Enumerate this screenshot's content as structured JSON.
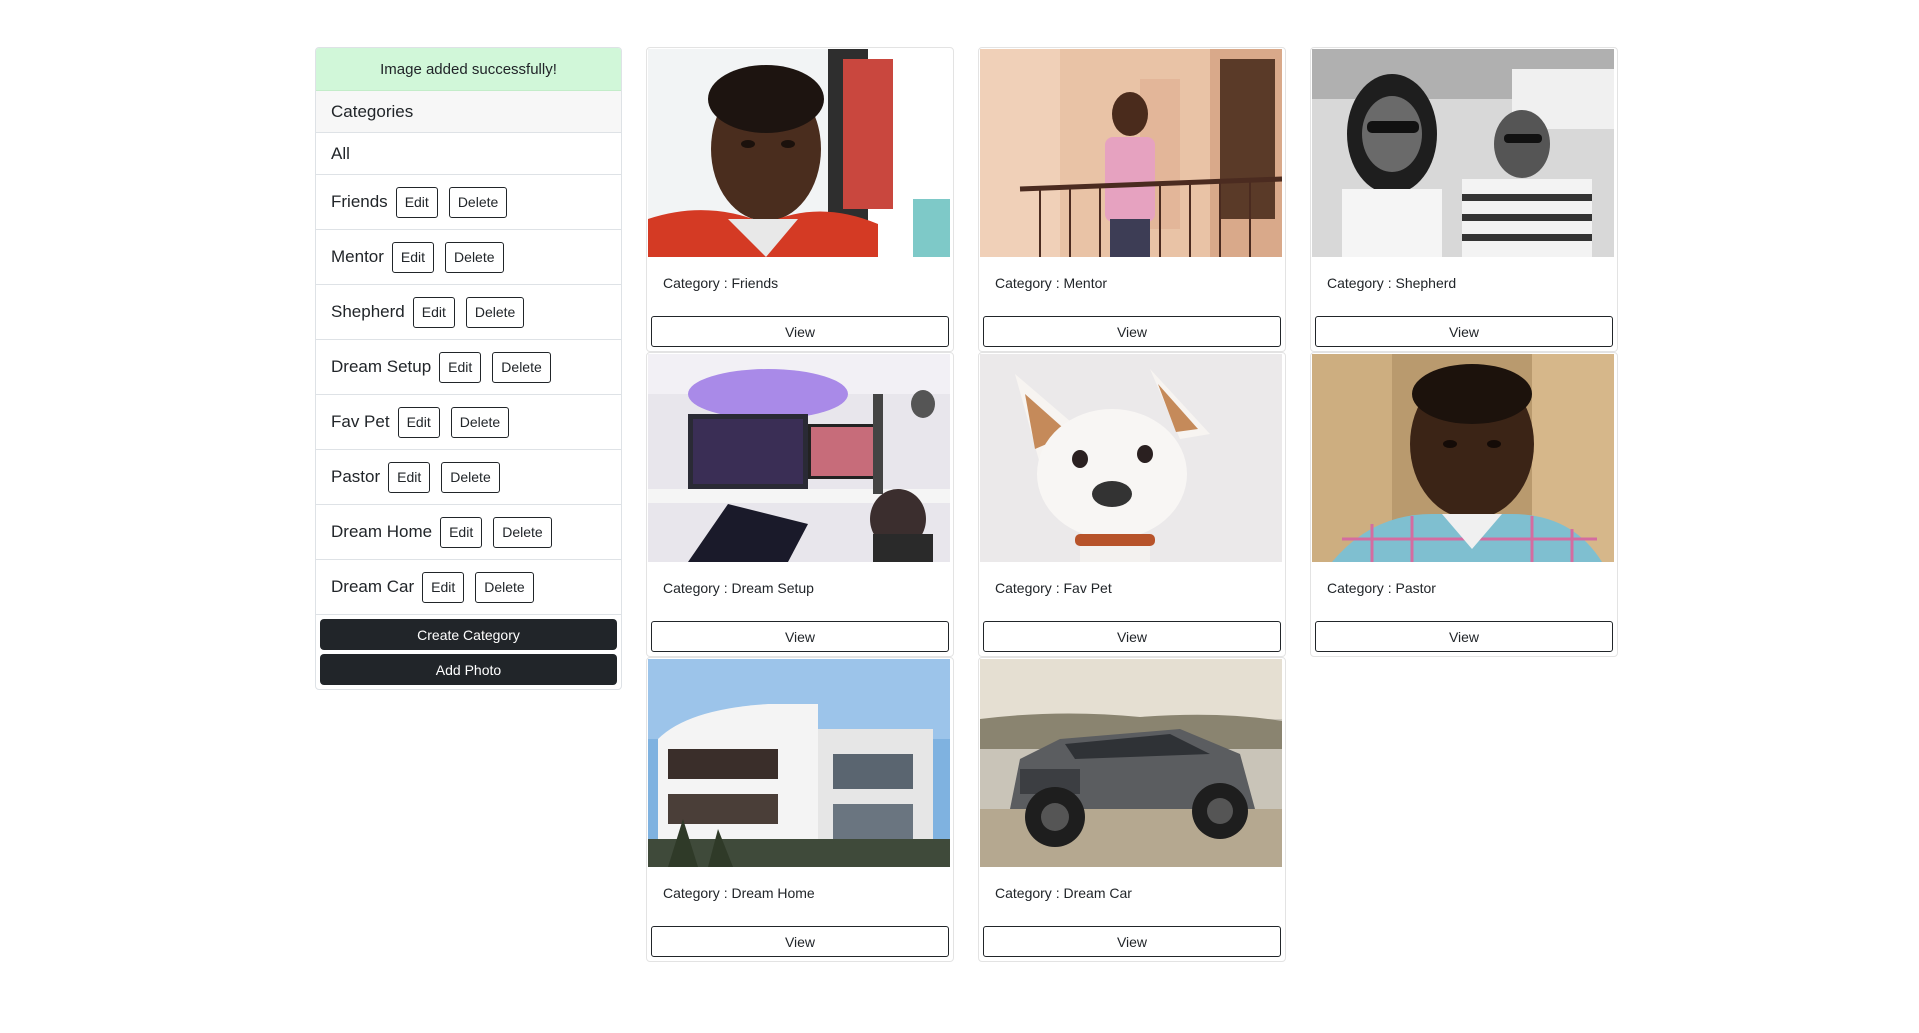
{
  "alert": {
    "message": "Image added successfully!"
  },
  "sidebar": {
    "header": "Categories",
    "all_label": "All",
    "edit_label": "Edit",
    "delete_label": "Delete",
    "items": [
      {
        "name": "Friends"
      },
      {
        "name": "Mentor"
      },
      {
        "name": "Shepherd"
      },
      {
        "name": "Dream Setup"
      },
      {
        "name": "Fav Pet"
      },
      {
        "name": "Pastor"
      },
      {
        "name": "Dream Home"
      },
      {
        "name": "Dream Car"
      }
    ],
    "create_category_label": "Create Category",
    "add_photo_label": "Add Photo"
  },
  "gallery": {
    "view_label": "View",
    "cards": [
      {
        "category": "Category : Friends",
        "image": "selfie of young man"
      },
      {
        "category": "Category : Mentor",
        "image": "man on balcony"
      },
      {
        "category": "Category : Shepherd",
        "image": "couple in car black and white"
      },
      {
        "category": "Category : Dream Setup",
        "image": "gaming desk setup"
      },
      {
        "category": "Category : Fav Pet",
        "image": "white dog"
      },
      {
        "category": "Category : Pastor",
        "image": "man in checkered shirt"
      },
      {
        "category": "Category : Dream Home",
        "image": "modern house"
      },
      {
        "category": "Category : Dream Car",
        "image": "grey pickup truck"
      }
    ]
  },
  "colors": {
    "alert_bg": "#d1f7d9",
    "dark_button": "#212529",
    "border": "#dee2e6"
  }
}
